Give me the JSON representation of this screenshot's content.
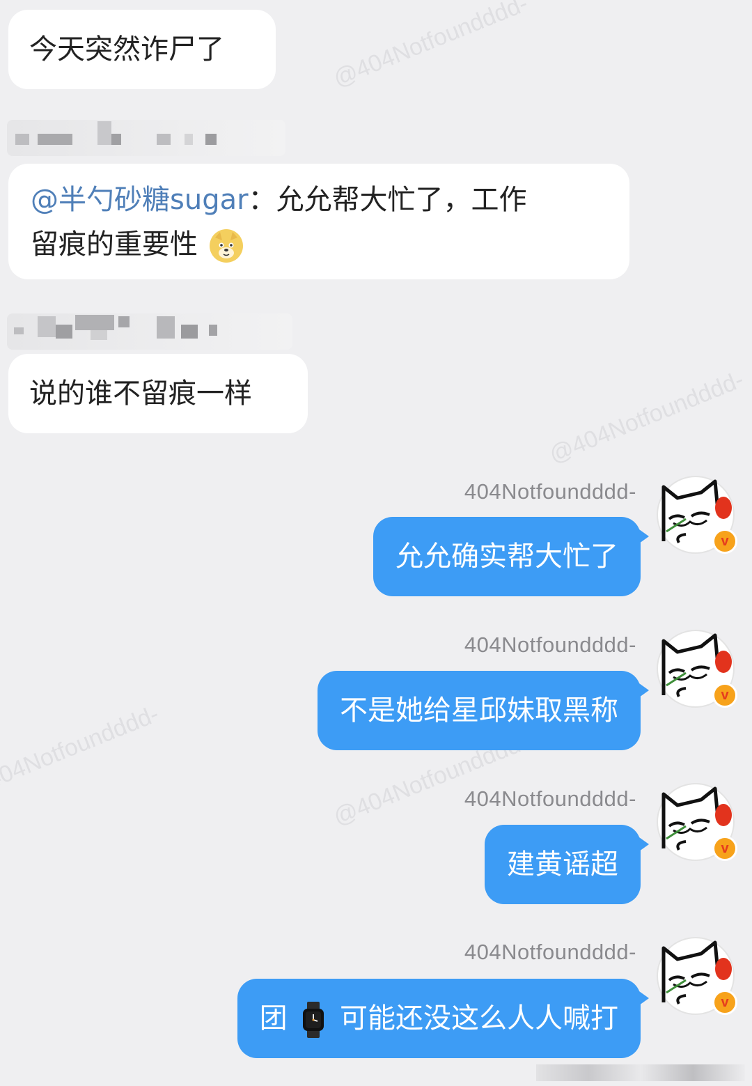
{
  "watermark": "@404Notfoundddd-",
  "messages_left": [
    {
      "text": "今天突然诈尸了"
    },
    {
      "mention": "@半勺砂糖sugar",
      "separator": "：",
      "text_line1": "允允帮大忙了，工作",
      "text_line2": "留痕的重要性",
      "emoji": "doge-emoji"
    },
    {
      "text": "说的谁不留痕一样"
    }
  ],
  "messages_right": [
    {
      "sender": "404Notfoundddd-",
      "text": "允允确实帮大忙了"
    },
    {
      "sender": "404Notfoundddd-",
      "text": "不是她给星邱妹取黑称"
    },
    {
      "sender": "404Notfoundddd-",
      "text": "建黄谣超"
    },
    {
      "sender": "404Notfoundddd-",
      "text_before": "团",
      "emoji": "watch-emoji",
      "text_after": "可能还没这么人人喊打"
    }
  ],
  "badge_letter": "v",
  "colors": {
    "bubble_self": "#3d9cf5",
    "bubble_other": "#ffffff",
    "background": "#efeff1",
    "mention": "#4f7fb8"
  }
}
